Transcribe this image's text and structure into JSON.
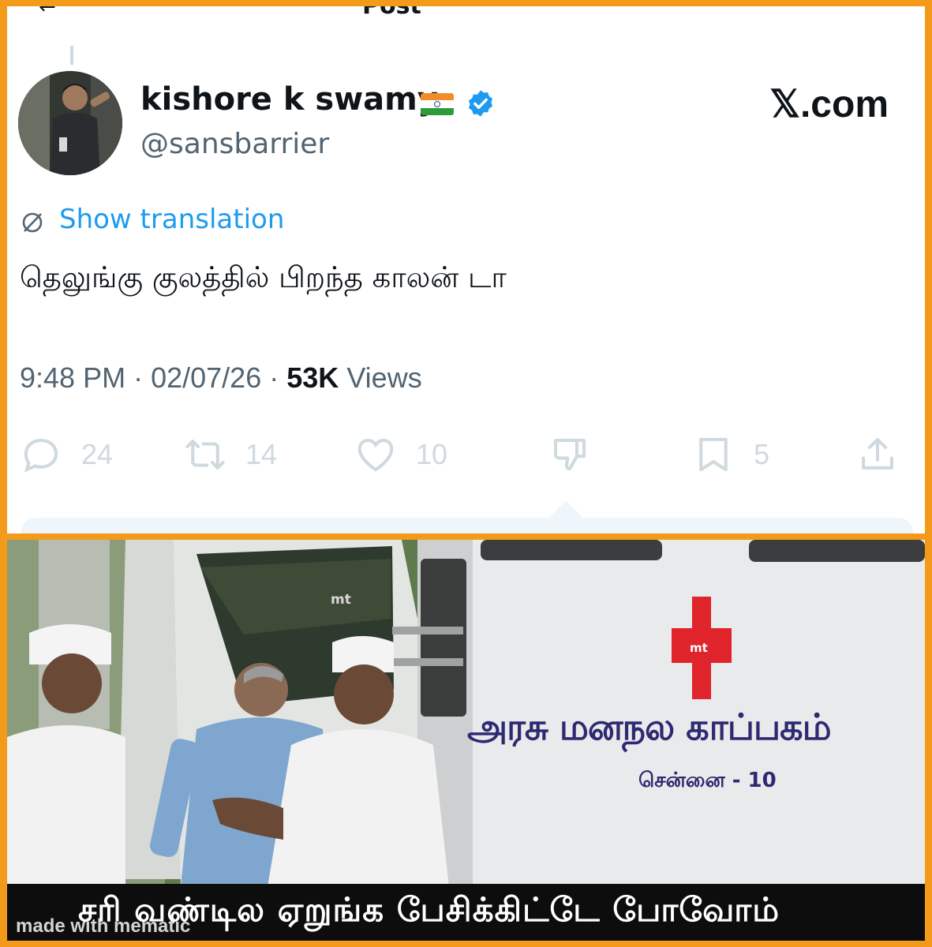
{
  "header": {
    "title_clip": "Post"
  },
  "author": {
    "display_name": "kishore k swamy",
    "handle": "@sansbarrier",
    "flag": "india-flag-emoji",
    "verified": "verified-badge-icon"
  },
  "site_label": "𝕏.com",
  "translation_link": "Show translation",
  "tweet_text": "தெலுங்கு குலத்தில் பிறந்த காலன் டா",
  "meta": {
    "time": "9:48 PM",
    "date": "02/07/26",
    "views_count": "53K",
    "views_label": "Views"
  },
  "actions": {
    "replies": "24",
    "reposts": "14",
    "likes": "10",
    "bookmarks": "5"
  },
  "image": {
    "van_title": "அரசு மனநல காப்பகம்",
    "van_subtitle": "சென்னை - 10",
    "van_logo": "mt",
    "cross_logo": "mt",
    "caption": "சரி வண்டில ஏறுங்க பேசிக்கிட்டே போவோம்",
    "watermark": "made with mematic"
  },
  "colors": {
    "frame": "#f39a1a",
    "link": "#1d9bf0",
    "muted": "#536471",
    "van_text": "#2e2a72",
    "cross": "#e0242b"
  }
}
